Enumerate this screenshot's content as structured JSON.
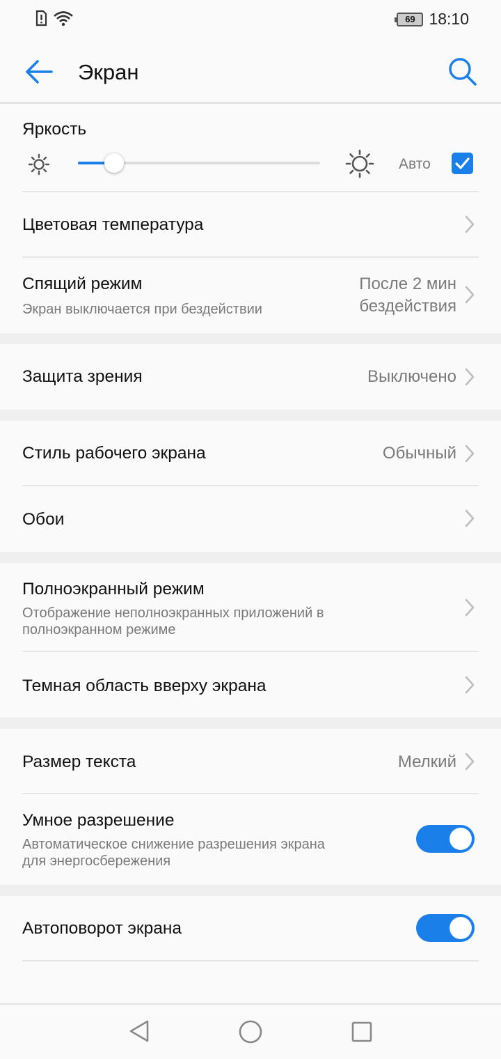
{
  "status_bar": {
    "time": "18:10",
    "battery": "69"
  },
  "app_bar": {
    "title": "Экран"
  },
  "brightness": {
    "title": "Яркость",
    "auto_label": "Авто",
    "auto_checked": true,
    "level": 0.15
  },
  "rows": {
    "color_temp": {
      "title": "Цветовая температура"
    },
    "sleep": {
      "title": "Спящий режим",
      "subtitle": "Экран выключается при бездействии",
      "value_line1": "После 2 мин",
      "value_line2": "бездействия"
    },
    "eye_comfort": {
      "title": "Защита зрения",
      "value": "Выключено"
    },
    "home_style": {
      "title": "Стиль рабочего экрана",
      "value": "Обычный"
    },
    "wallpaper": {
      "title": "Обои"
    },
    "fullscreen": {
      "title": "Полноэкранный режим",
      "subtitle_line1": "Отображение неполноэкранных приложений в",
      "subtitle_line2": "полноэкранном режиме"
    },
    "notch": {
      "title": "Темная область вверху экрана"
    },
    "text_size": {
      "title": "Размер текста",
      "value": "Мелкий"
    },
    "smart_resolution": {
      "title": "Умное разрешение",
      "subtitle_line1": "Автоматическое снижение разрешения экрана",
      "subtitle_line2": "для энергосбережения",
      "enabled": true
    },
    "auto_rotate": {
      "title": "Автоповорот экрана",
      "enabled": true
    }
  },
  "icons": {
    "back": "arrow-left-icon",
    "search": "search-icon",
    "sun_small": "sun-small-icon",
    "sun_large": "sun-large-icon",
    "chevron": "chevron-right-icon",
    "nav_back": "triangle-back-icon",
    "nav_home": "circle-home-icon",
    "nav_recent": "square-recent-icon"
  },
  "colors": {
    "accent": "#1a7fe8",
    "background": "#fafafa",
    "section_gap": "#efefef",
    "secondary_text": "#7a7a7a"
  }
}
